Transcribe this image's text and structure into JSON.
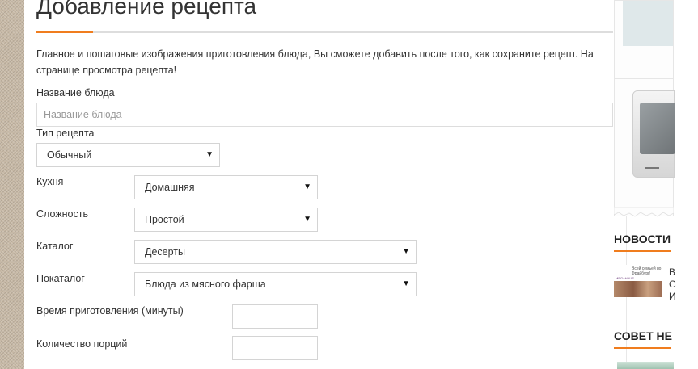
{
  "main": {
    "title": "Добавление рецепта",
    "info": "Главное и пошаговые изображения приготовления блюда, Вы сможете добавить после того, как сохраните рецепт. На странице просмотра рецепта!",
    "dish_name": {
      "label": "Название блюда",
      "placeholder": "Название блюда",
      "value": ""
    },
    "recipe_type": {
      "label": "Тип рецепта",
      "value": "Обычный"
    },
    "cuisine": {
      "label": "Кухня",
      "value": "Домашняя"
    },
    "difficulty": {
      "label": "Сложность",
      "value": "Простой"
    },
    "catalog": {
      "label": "Каталог",
      "value": "Десерты"
    },
    "subcatalog": {
      "label": "Покаталог",
      "value": "Блюда из мясного фарша"
    },
    "cook_time": {
      "label": "Время приготовления (минуты)",
      "value": ""
    },
    "servings": {
      "label": "Количество порций",
      "value": ""
    },
    "dropdown_arrow": "▼"
  },
  "sidebar": {
    "news_title": "НОВОСТИ",
    "news_item": {
      "thumb_logo": "MEGAHAUS",
      "thumb_caption": "Всей семьей во Фрайбург!",
      "lines": [
        "В",
        "С",
        "И"
      ]
    },
    "tip_title": "СОВЕТ НЕ"
  },
  "colors": {
    "accent": "#f07d1e",
    "border": "#d4d4d4",
    "text": "#333333"
  }
}
